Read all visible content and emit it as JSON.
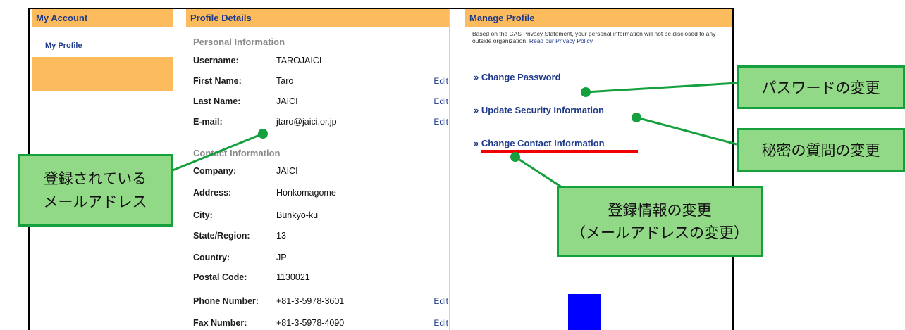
{
  "my_account": {
    "header": "My Account",
    "nav_items": [
      "My Profile"
    ]
  },
  "profile_details": {
    "header": "Profile Details",
    "personal_title": "Personal Information",
    "personal": [
      {
        "label": "Username:",
        "value": "TAROJAICI",
        "edit": ""
      },
      {
        "label": "First Name:",
        "value": "Taro",
        "edit": "Edit"
      },
      {
        "label": "Last Name:",
        "value": "JAICI",
        "edit": "Edit"
      },
      {
        "label": "E-mail:",
        "value": "jtaro@jaici.or.jp",
        "edit": "Edit"
      }
    ],
    "contact_title": "Contact Information",
    "contact": [
      {
        "label": "Company:",
        "value": "JAICI",
        "edit": ""
      },
      {
        "label": "Address:",
        "value": "Honkomagome",
        "edit": ""
      },
      {
        "label": "City:",
        "value": "Bunkyo-ku",
        "edit": ""
      },
      {
        "label": "State/Region:",
        "value": "13",
        "edit": ""
      },
      {
        "label": "Country:",
        "value": "JP",
        "edit": ""
      },
      {
        "label": "Postal Code:",
        "value": "1130021",
        "edit": ""
      },
      {
        "label": "Phone Number:",
        "value": "+81-3-5978-3601",
        "edit": "Edit"
      },
      {
        "label": "Fax Number:",
        "value": "+81-3-5978-4090",
        "edit": "Edit"
      }
    ]
  },
  "manage_profile": {
    "header": "Manage Profile",
    "privacy_text": "Based on the CAS Privacy Statement, your personal information will not be disclosed to any outside organization.",
    "privacy_link": "Read our Privacy Policy",
    "actions": [
      "» Change Password",
      "» Update Security Information",
      "» Change Contact Information"
    ]
  },
  "callouts": {
    "email_line1": "登録されている",
    "email_line2": "メールアドレス",
    "password": "パスワードの変更",
    "security": "秘密の質問の変更",
    "contact_line1": "登録情報の変更",
    "contact_line2": "（メールアドレスの変更）"
  },
  "colors": {
    "header_bg": "#fcbc5e",
    "link": "#1f3a8a",
    "callout_bg": "#92d987",
    "callout_border": "#14a03c",
    "underline": "#f00000",
    "block": "#0000ff"
  }
}
